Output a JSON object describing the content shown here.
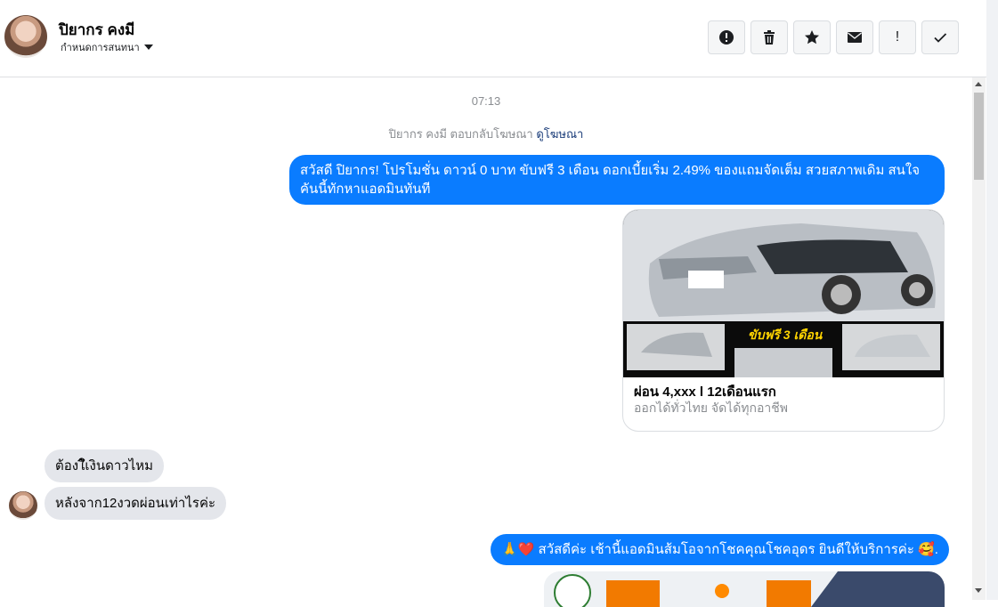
{
  "header": {
    "contact_name": "ปิยากร คงมี",
    "subtitle": "กำหนดการสนทนา",
    "toolbar": [
      {
        "name": "report-button",
        "icon": "alert-circle-icon"
      },
      {
        "name": "delete-button",
        "icon": "trash-icon"
      },
      {
        "name": "star-button",
        "icon": "star-icon"
      },
      {
        "name": "mark-unread-button",
        "icon": "envelope-icon"
      },
      {
        "name": "important-button",
        "label": "!"
      },
      {
        "name": "done-button",
        "icon": "check-icon"
      }
    ]
  },
  "thread": {
    "timestamp": "07:13",
    "reply_note": "ปิยากร คงมี ตอบกลับโฆษณา",
    "view_ad_link": "ดูโฆษณา",
    "messages": [
      {
        "from": "page",
        "text": "สวัสดี ปิยากร! โปรโมชั่น ดาวน์ 0 บาท ขับฟรี 3 เดือน ดอกเบี้ยเริ่ม 2.49% ของแถมจัดเต็ม สวยสภาพเดิม สนใจ คันนี้ทักหาแอดมินทันที"
      },
      {
        "from": "user",
        "text": "ต้องใึเงินดาวไหม"
      },
      {
        "from": "user",
        "text": "หลังจาก12งวดผ่อนเท่าไรค่ะ"
      },
      {
        "from": "page",
        "text": "🙏❤️ สวัสดีค่ะ เช้านี้แอดมินส้มโอจากโชคคุณโชคอุดร ยินดีให้บริการค่ะ 🥰."
      }
    ],
    "ad_card": {
      "banner_text": "ขับฟรี 3 เดือน",
      "title": "ผ่อน 4,xxx l 12เดือนแรก",
      "subtitle": "ออกได้ทั่วไทย จัดได้ทุกอาชีพ"
    }
  },
  "colors": {
    "outgoing_bubble": "#0a7cff",
    "incoming_bubble": "#e4e6eb"
  }
}
